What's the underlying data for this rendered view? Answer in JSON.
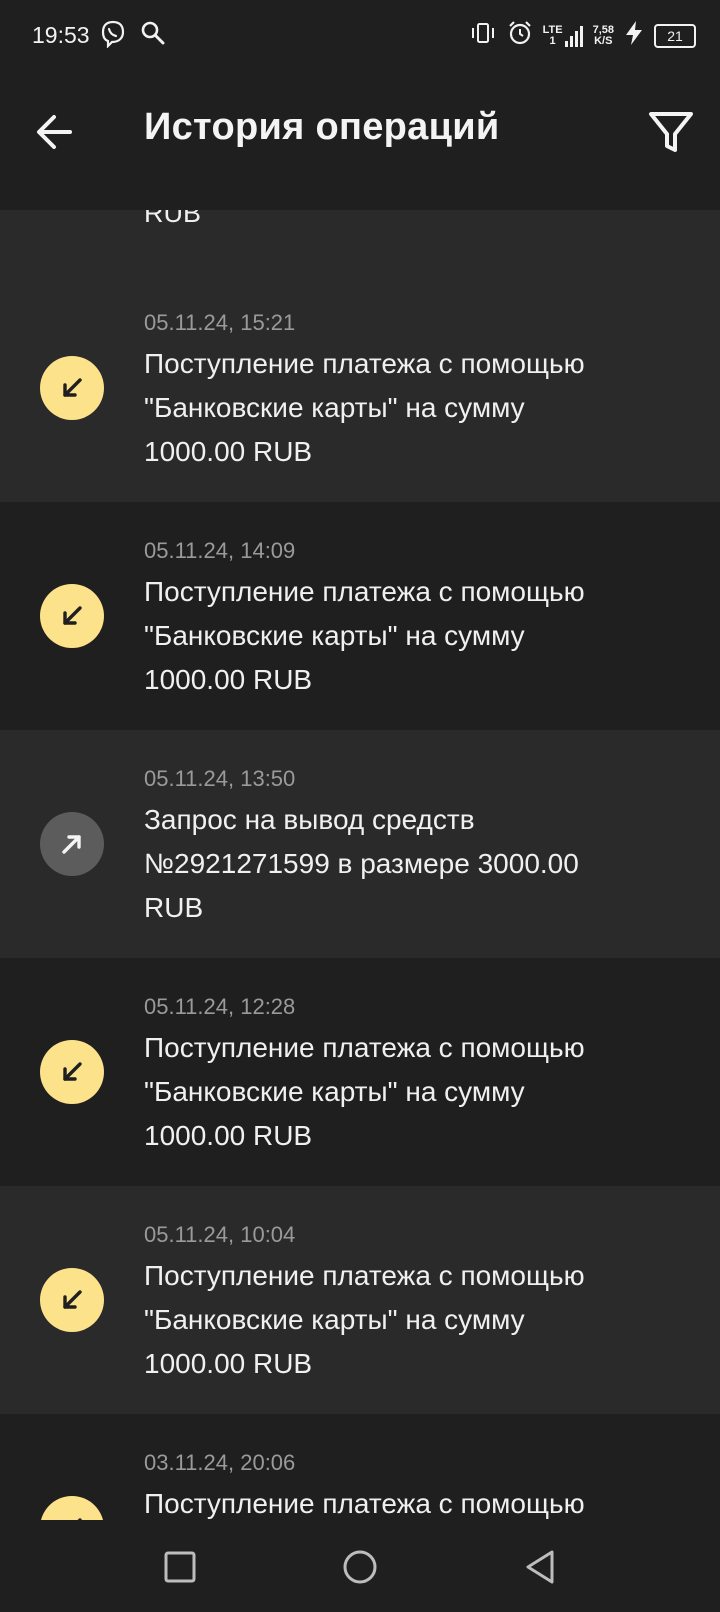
{
  "status": {
    "time": "19:53",
    "network_top": "LTE",
    "network_bottom": "1",
    "speed_top": "7,58",
    "speed_bottom": "K/S",
    "battery": "21"
  },
  "header": {
    "title": "История операций"
  },
  "partial_item_text": "RUB",
  "transactions": [
    {
      "date": "05.11.24, 15:21",
      "line1": "Поступление платежа с помощью",
      "line2": "\"Банковские карты\" на сумму",
      "line3": "1000.00 RUB",
      "direction": "incoming"
    },
    {
      "date": "05.11.24, 14:09",
      "line1": "Поступление платежа с помощью",
      "line2": "\"Банковские карты\" на сумму",
      "line3": "1000.00 RUB",
      "direction": "incoming"
    },
    {
      "date": "05.11.24, 13:50",
      "line1": "Запрос на вывод средств",
      "line2": "№2921271599 в размере 3000.00",
      "line3": "RUB",
      "direction": "outgoing"
    },
    {
      "date": "05.11.24, 12:28",
      "line1": "Поступление платежа с помощью",
      "line2": "\"Банковские карты\" на сумму",
      "line3": "1000.00 RUB",
      "direction": "incoming"
    },
    {
      "date": "05.11.24, 10:04",
      "line1": "Поступление платежа с помощью",
      "line2": "\"Банковские карты\" на сумму",
      "line3": "1000.00 RUB",
      "direction": "incoming"
    },
    {
      "date": "03.11.24, 20:06",
      "line1": "Поступление платежа с помощью",
      "line2": "",
      "line3": "",
      "direction": "incoming"
    }
  ],
  "colors": {
    "incoming_icon": "#fde28c",
    "outgoing_icon": "#5c5c5c",
    "row_light": "#2a2a2a",
    "row_dark": "#1f1f1f"
  }
}
